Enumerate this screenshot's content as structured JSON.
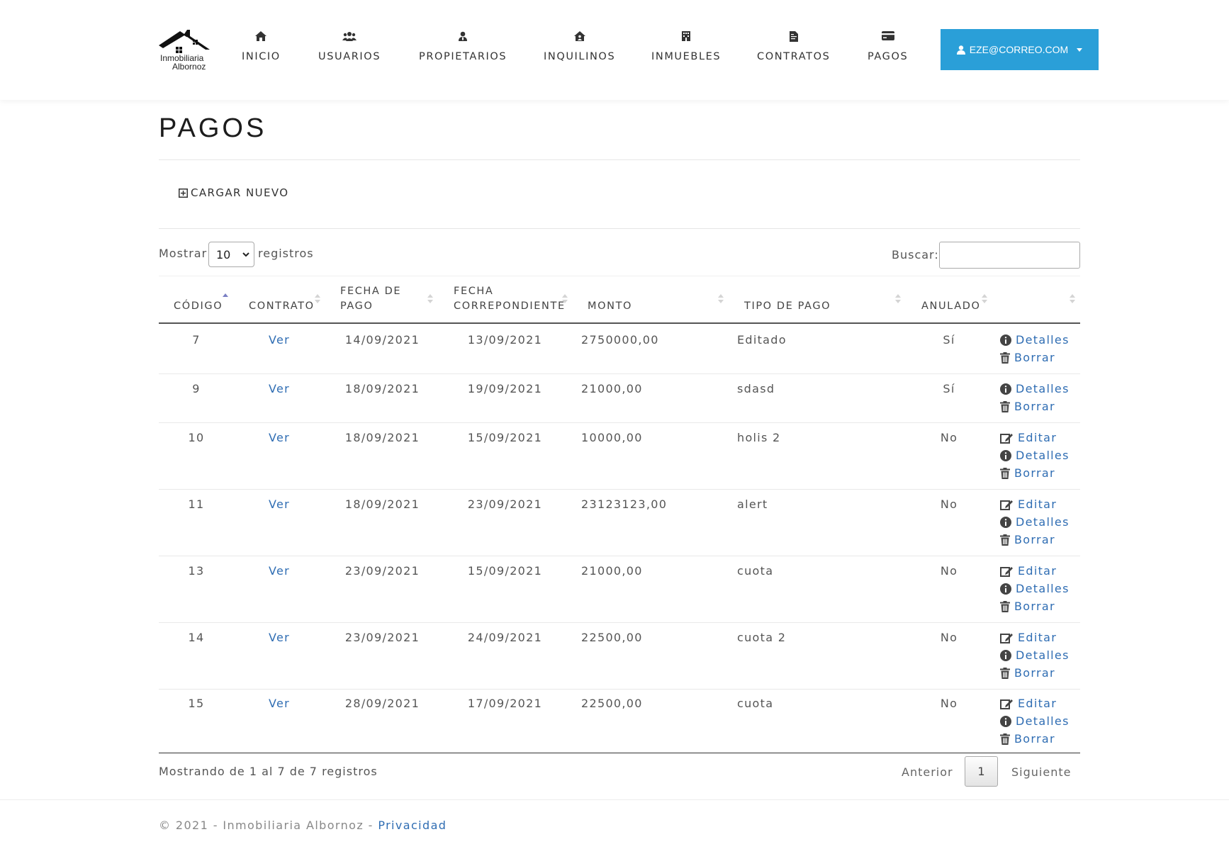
{
  "brand": {
    "logo_line1": "Inmobiliaria",
    "logo_line2": "Albornoz"
  },
  "nav": [
    {
      "label": "INICIO",
      "icon": "home-icon"
    },
    {
      "label": "USUARIOS",
      "icon": "users-icon"
    },
    {
      "label": "PROPIETARIOS",
      "icon": "user-tie-icon"
    },
    {
      "label": "INQUILINOS",
      "icon": "house-user-icon"
    },
    {
      "label": "INMUEBLES",
      "icon": "building-icon"
    },
    {
      "label": "CONTRATOS",
      "icon": "file-contract-icon"
    },
    {
      "label": "PAGOS",
      "icon": "credit-card-icon"
    }
  ],
  "user": {
    "email": "EZE@CORREO.COM",
    "button_color": "#2a9fd8"
  },
  "page": {
    "title": "PAGOS",
    "new_label": "CARGAR NUEVO"
  },
  "controls": {
    "show_prefix": "Mostrar",
    "page_size": "10",
    "show_suffix": "registros",
    "search_label": "Buscar:",
    "search_value": ""
  },
  "table": {
    "headers": {
      "codigo": "CÓDIGO",
      "contrato": "CONTRATO",
      "fecha_pago_1": "FECHA DE",
      "fecha_pago_2": "PAGO",
      "fecha_corr_1": "FECHA",
      "fecha_corr_2": "CORREPONDIENTE",
      "monto": "MONTO",
      "tipo": "TIPO DE PAGO",
      "anulado": "ANULADO"
    },
    "sorted_column": "codigo",
    "sort_direction": "asc",
    "rows": [
      {
        "codigo": "7",
        "contrato": "Ver",
        "fecha_pago": "14/09/2021",
        "fecha_corr": "13/09/2021",
        "monto": "2750000,00",
        "tipo": "Editado",
        "anulado": "Sí",
        "actions": [
          "Detalles",
          "Borrar"
        ]
      },
      {
        "codigo": "9",
        "contrato": "Ver",
        "fecha_pago": "18/09/2021",
        "fecha_corr": "19/09/2021",
        "monto": "21000,00",
        "tipo": "sdasd",
        "anulado": "Sí",
        "actions": [
          "Detalles",
          "Borrar"
        ]
      },
      {
        "codigo": "10",
        "contrato": "Ver",
        "fecha_pago": "18/09/2021",
        "fecha_corr": "15/09/2021",
        "monto": "10000,00",
        "tipo": "holis 2",
        "anulado": "No",
        "actions": [
          "Editar",
          "Detalles",
          "Borrar"
        ]
      },
      {
        "codigo": "11",
        "contrato": "Ver",
        "fecha_pago": "18/09/2021",
        "fecha_corr": "23/09/2021",
        "monto": "23123123,00",
        "tipo": "alert",
        "anulado": "No",
        "actions": [
          "Editar",
          "Detalles",
          "Borrar"
        ]
      },
      {
        "codigo": "13",
        "contrato": "Ver",
        "fecha_pago": "23/09/2021",
        "fecha_corr": "15/09/2021",
        "monto": "21000,00",
        "tipo": "cuota",
        "anulado": "No",
        "actions": [
          "Editar",
          "Detalles",
          "Borrar"
        ]
      },
      {
        "codigo": "14",
        "contrato": "Ver",
        "fecha_pago": "23/09/2021",
        "fecha_corr": "24/09/2021",
        "monto": "22500,00",
        "tipo": "cuota 2",
        "anulado": "No",
        "actions": [
          "Editar",
          "Detalles",
          "Borrar"
        ]
      },
      {
        "codigo": "15",
        "contrato": "Ver",
        "fecha_pago": "28/09/2021",
        "fecha_corr": "17/09/2021",
        "monto": "22500,00",
        "tipo": "cuota",
        "anulado": "No",
        "actions": [
          "Editar",
          "Detalles",
          "Borrar"
        ]
      }
    ]
  },
  "pagination": {
    "info": "Mostrando de 1 al 7 de 7 registros",
    "prev": "Anterior",
    "current": "1",
    "next": "Siguiente"
  },
  "footer": {
    "text": "© 2021 - Inmobiliaria Albornoz - ",
    "link": "Privacidad"
  },
  "colors": {
    "link": "#2f6db3",
    "sort_active": "#7a7fc4"
  }
}
